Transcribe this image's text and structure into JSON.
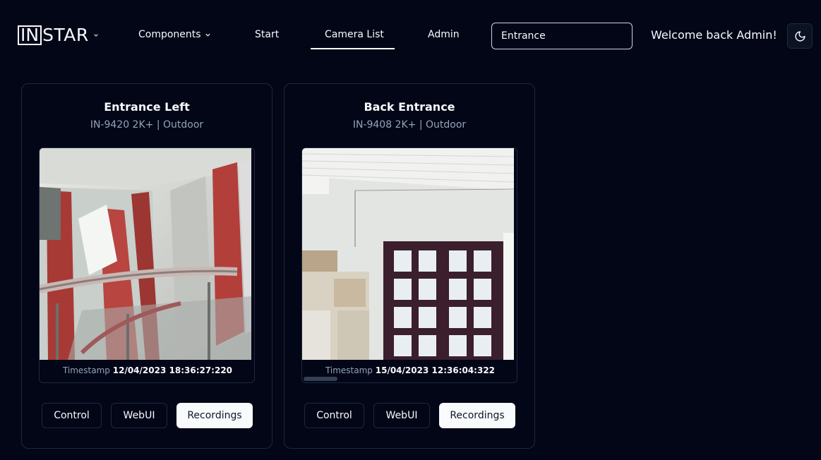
{
  "header": {
    "logo": {
      "boxed": "IN",
      "rest": "STAR"
    },
    "nav": [
      {
        "label": "Components"
      },
      {
        "label": "Start"
      },
      {
        "label": "Camera List"
      },
      {
        "label": "Admin"
      }
    ],
    "search": {
      "value": "Entrance",
      "placeholder": ""
    },
    "welcome": "Welcome back Admin!",
    "theme_icon": "moon-icon"
  },
  "cameras": [
    {
      "title": "Entrance Left",
      "subtitle": "IN-9420 2K+ | Outdoor",
      "timestamp_label": "Timestamp",
      "timestamp": "12/04/2023 18:36:27:220",
      "buttons": {
        "control": "Control",
        "webui": "WebUI",
        "recordings": "Recordings"
      }
    },
    {
      "title": "Back Entrance",
      "subtitle": "IN-9408 2K+ | Outdoor",
      "timestamp_label": "Timestamp",
      "timestamp": "15/04/2023 12:36:04:322",
      "buttons": {
        "control": "Control",
        "webui": "WebUI",
        "recordings": "Recordings"
      }
    }
  ],
  "colors": {
    "background": "#020617",
    "border": "#1e293b",
    "muted": "#94a3b8",
    "foreground": "#f8fafc"
  }
}
